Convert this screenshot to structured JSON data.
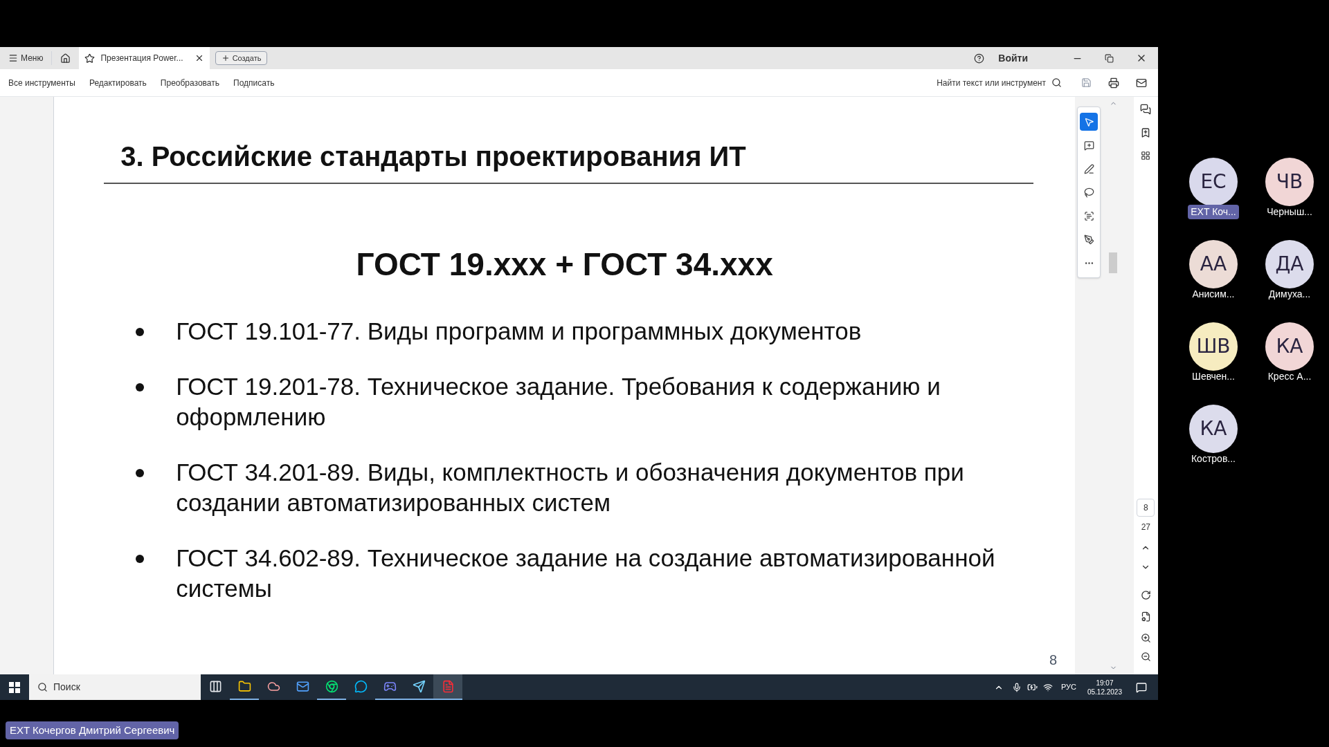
{
  "app": {
    "menu_label": "Меню",
    "tabs": [
      {
        "title": "Презентация Power...",
        "selected": true
      }
    ],
    "new_tab_label": "Создать",
    "sign_in": "Войти"
  },
  "toolbar": {
    "items": [
      "Все инструменты",
      "Редактировать",
      "Преобразовать",
      "Подписать"
    ],
    "search_label": "Найти текст или инструмент"
  },
  "slide": {
    "title": "3. Российские стандарты проектирования ИТ",
    "heading": "ГОСТ 19.xxx + ГОСТ 34.xxx",
    "bullets": [
      "ГОСТ 19.101-77. Виды программ и программных документов",
      "ГОСТ 19.201-78. Техническое задание. Требования к содержанию и оформлению",
      "ГОСТ 34.201-89. Виды, комплектность и обозначения документов при создании автоматизированных систем",
      "ГОСТ 34.602-89. Техническое задание на создание автоматизированной системы"
    ],
    "page_number": "8"
  },
  "tools": [
    {
      "kind": "select",
      "selected": true
    },
    {
      "kind": "comment",
      "selected": false
    },
    {
      "kind": "pen",
      "selected": false
    },
    {
      "kind": "lasso",
      "selected": false
    },
    {
      "kind": "text",
      "selected": false
    },
    {
      "kind": "sign",
      "selected": false
    },
    {
      "kind": "more",
      "selected": false
    }
  ],
  "page_nav": {
    "current": "8",
    "total": "27"
  },
  "taskbar": {
    "search_placeholder": "Поиск",
    "apps": [
      {
        "kind": "taskview",
        "running": false,
        "active": false
      },
      {
        "kind": "explorer",
        "running": true,
        "active": false
      },
      {
        "kind": "cloud",
        "running": false,
        "active": false
      },
      {
        "kind": "outlook",
        "running": false,
        "active": false
      },
      {
        "kind": "chrome",
        "running": true,
        "active": false
      },
      {
        "kind": "skype",
        "running": false,
        "active": false
      },
      {
        "kind": "discord",
        "running": true,
        "active": false
      },
      {
        "kind": "telegram",
        "running": true,
        "active": false
      },
      {
        "kind": "acrobat",
        "running": true,
        "active": true
      }
    ],
    "language": "РУС",
    "time": "19:07",
    "date": "05.12.2023"
  },
  "participants": [
    {
      "initials": "EC",
      "name": "EXT Коч...",
      "color": "#d9d9ec",
      "speaking": true
    },
    {
      "initials": "ЧВ",
      "name": "Черныш...",
      "color": "#f1d6d6",
      "speaking": false
    },
    {
      "initials": "АА",
      "name": "Анисим...",
      "color": "#ecdcd6",
      "speaking": false
    },
    {
      "initials": "ДА",
      "name": "Димуха...",
      "color": "#dcdcec",
      "speaking": false
    },
    {
      "initials": "ШВ",
      "name": "Шевчен...",
      "color": "#f6ecc0",
      "speaking": false
    },
    {
      "initials": "КА",
      "name": "Кресс А...",
      "color": "#f1d6d6",
      "speaking": false
    },
    {
      "initials": "КА",
      "name": "Костров...",
      "color": "#dcdcec",
      "speaking": false
    }
  ],
  "presenter_label": "EXT Кочергов Дмитрий Сергеевич"
}
